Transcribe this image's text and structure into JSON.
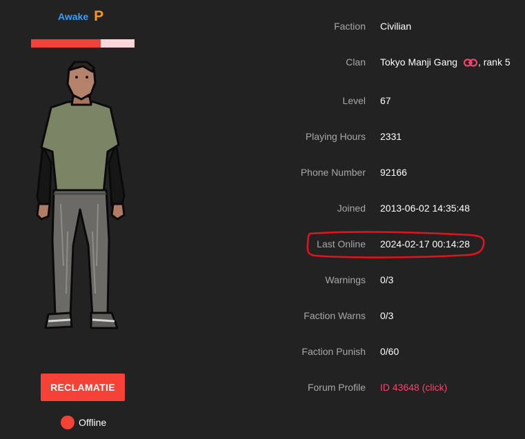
{
  "user": {
    "name": "Awake",
    "premium_badge": "P",
    "health_percent": 67
  },
  "actions": {
    "reclamatie_label": "RECLAMATIE"
  },
  "status": {
    "label": "Offline",
    "color": "#f44336"
  },
  "info": {
    "faction": {
      "label": "Faction",
      "value": "Civilian"
    },
    "clan": {
      "label": "Clan",
      "name": "Tokyo Manji Gang",
      "rank_text": ", rank 5"
    },
    "level": {
      "label": "Level",
      "value": "67"
    },
    "playing_hours": {
      "label": "Playing Hours",
      "value": "2331"
    },
    "phone_number": {
      "label": "Phone Number",
      "value": "92166"
    },
    "joined": {
      "label": "Joined",
      "value": "2013-06-02 14:35:48"
    },
    "last_online": {
      "label": "Last Online",
      "value": "2024-02-17 00:14:28"
    },
    "warnings": {
      "label": "Warnings",
      "value": "0/3"
    },
    "faction_warns": {
      "label": "Faction Warns",
      "value": "0/3"
    },
    "faction_punish": {
      "label": "Faction Punish",
      "value": "0/60"
    },
    "forum_profile": {
      "label": "Forum Profile",
      "value": "ID 43648 (click)"
    }
  },
  "colors": {
    "background": "#222222",
    "username": "#3b9cf4",
    "premium": "#f59a12",
    "accent_red": "#f44336",
    "link_pink": "#f2466e",
    "label_gray": "#a8a8a8",
    "annotation_red": "#e0141e"
  },
  "icons": {
    "clan_link": "link-icon",
    "skin": "character-skin-image"
  }
}
